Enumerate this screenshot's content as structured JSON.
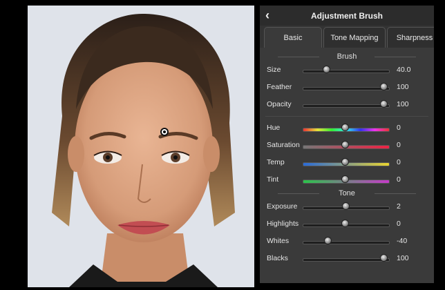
{
  "panel": {
    "title": "Adjustment Brush",
    "back_icon": "chevron-left-icon"
  },
  "tabs": [
    {
      "label": "Basic",
      "active": true
    },
    {
      "label": "Tone Mapping",
      "active": false
    },
    {
      "label": "Sharpness",
      "active": false
    }
  ],
  "sections": {
    "brush": "Brush",
    "tone": "Tone"
  },
  "brush_sliders": [
    {
      "label": "Size",
      "value": "40.0",
      "level": 0.28
    },
    {
      "label": "Feather",
      "value": "100",
      "level": 0.95
    },
    {
      "label": "Opacity",
      "value": "100",
      "level": 0.95
    }
  ],
  "color_sliders": [
    {
      "label": "Hue",
      "value": "0",
      "level": 0.5,
      "gradient": "grad-hue"
    },
    {
      "label": "Saturation",
      "value": "0",
      "level": 0.5,
      "gradient": "grad-sat"
    },
    {
      "label": "Temp",
      "value": "0",
      "level": 0.5,
      "gradient": "grad-temp"
    },
    {
      "label": "Tint",
      "value": "0",
      "level": 0.5,
      "gradient": "grad-tint"
    }
  ],
  "tone_sliders": [
    {
      "label": "Exposure",
      "value": "2",
      "level": 0.51
    },
    {
      "label": "Highlights",
      "value": "0",
      "level": 0.5
    },
    {
      "label": "Whites",
      "value": "-40",
      "level": 0.3
    },
    {
      "label": "Blacks",
      "value": "100",
      "level": 0.95
    }
  ],
  "colors": {
    "panel_bg": "#3a3a3a",
    "header_bg": "#2c2c2c",
    "text": "#e6e6e6"
  }
}
